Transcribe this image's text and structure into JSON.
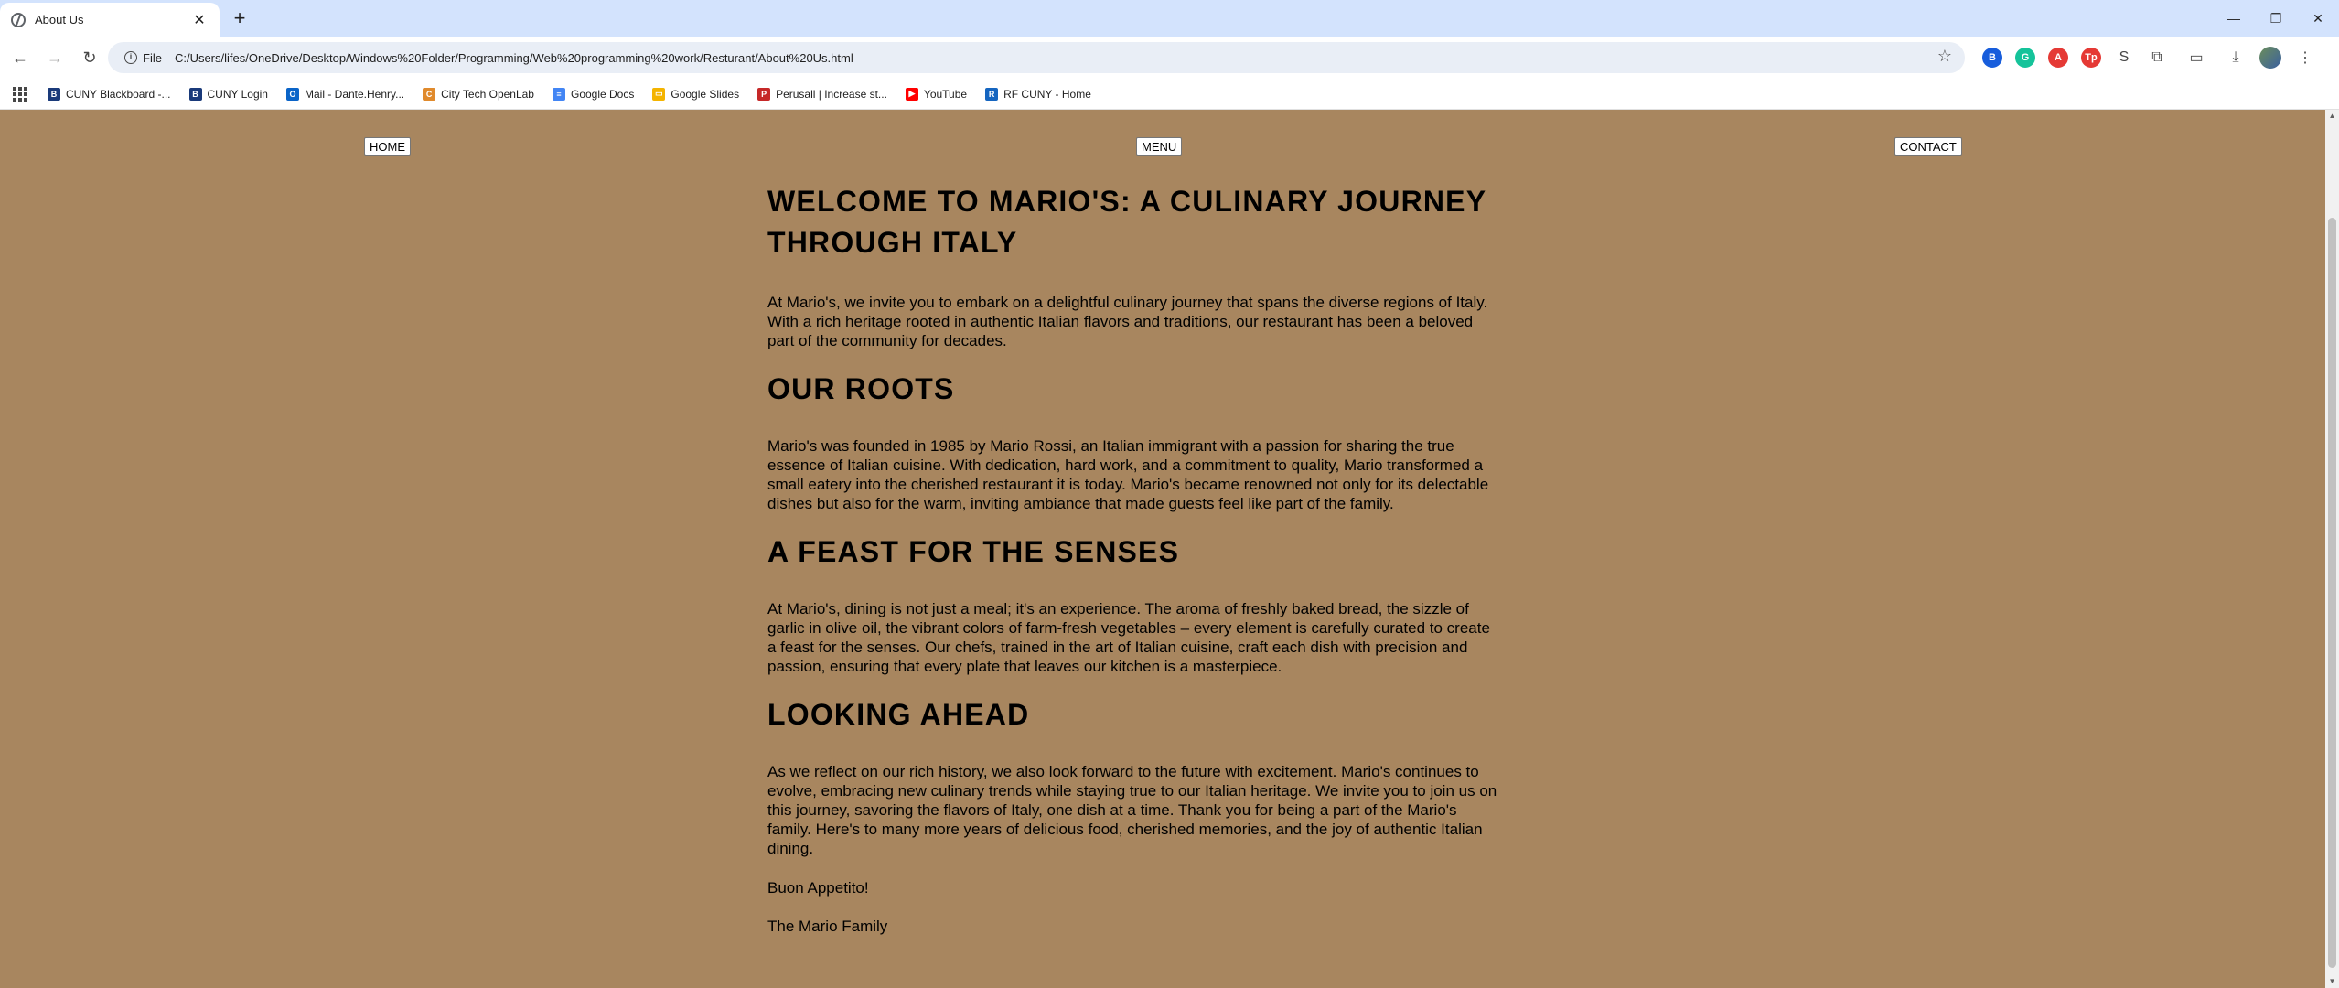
{
  "browser": {
    "tab_title": "About Us",
    "new_tab_symbol": "+",
    "site_chip": "File",
    "url": "C:/Users/lifes/OneDrive/Desktop/Windows%20Folder/Programming/Web%20programming%20work/Resturant/About%20Us.html",
    "bookmarks": [
      {
        "label": "CUNY Blackboard -...",
        "icon": "cuny-icon",
        "color": "#1a3a7a",
        "glyph": "B"
      },
      {
        "label": "CUNY Login",
        "icon": "cuny-icon",
        "color": "#1a3a7a",
        "glyph": "B"
      },
      {
        "label": "Mail - Dante.Henry...",
        "icon": "outlook-icon",
        "color": "#0a64c8",
        "glyph": "O"
      },
      {
        "label": "City Tech OpenLab",
        "icon": "openlab-icon",
        "color": "#e08a2c",
        "glyph": "C"
      },
      {
        "label": "Google Docs",
        "icon": "docs-icon",
        "color": "#4285f4",
        "glyph": "≡"
      },
      {
        "label": "Google Slides",
        "icon": "slides-icon",
        "color": "#f4b400",
        "glyph": "▭"
      },
      {
        "label": "Perusall | Increase st...",
        "icon": "perusall-icon",
        "color": "#c62828",
        "glyph": "P"
      },
      {
        "label": "YouTube",
        "icon": "youtube-icon",
        "color": "#ff0000",
        "glyph": "▶"
      },
      {
        "label": "RF CUNY - Home",
        "icon": "rfcuny-icon",
        "color": "#1565c0",
        "glyph": "R"
      }
    ],
    "extensions": [
      {
        "icon": "bitwarden-icon",
        "color": "#175ddc",
        "glyph": "B"
      },
      {
        "icon": "grammarly-icon",
        "color": "#15c39a",
        "glyph": "G"
      },
      {
        "icon": "adblock-icon",
        "color": "#e53935",
        "glyph": "A"
      },
      {
        "icon": "tp-icon",
        "color": "#e53935",
        "glyph": "Tp"
      },
      {
        "icon": "script-icon",
        "color": "",
        "glyph": "S"
      },
      {
        "icon": "puzzle-icon",
        "color": "",
        "glyph": "⧉"
      }
    ]
  },
  "nav": {
    "home": "HOME",
    "menu": "MENU",
    "contact": "CONTACT"
  },
  "article": {
    "title": "WELCOME TO MARIO'S: A CULINARY JOURNEY THROUGH ITALY",
    "intro": "At Mario's, we invite you to embark on a delightful culinary journey that spans the diverse regions of Italy. With a rich heritage rooted in authentic Italian flavors and traditions, our restaurant has been a beloved part of the community for decades.",
    "sections": [
      {
        "heading": "OUR ROOTS",
        "body": "Mario's was founded in 1985 by Mario Rossi, an Italian immigrant with a passion for sharing the true essence of Italian cuisine. With dedication, hard work, and a commitment to quality, Mario transformed a small eatery into the cherished restaurant it is today. Mario's became renowned not only for its delectable dishes but also for the warm, inviting ambiance that made guests feel like part of the family."
      },
      {
        "heading": "A FEAST FOR THE SENSES",
        "body": "At Mario's, dining is not just a meal; it's an experience. The aroma of freshly baked bread, the sizzle of garlic in olive oil, the vibrant colors of farm-fresh vegetables – every element is carefully curated to create a feast for the senses. Our chefs, trained in the art of Italian cuisine, craft each dish with precision and passion, ensuring that every plate that leaves our kitchen is a masterpiece."
      },
      {
        "heading": "LOOKING AHEAD",
        "body": "As we reflect on our rich history, we also look forward to the future with excitement. Mario's continues to evolve, embracing new culinary trends while staying true to our Italian heritage. We invite you to join us on this journey, savoring the flavors of Italy, one dish at a time. Thank you for being a part of the Mario's family. Here's to many more years of delicious food, cherished memories, and the joy of authentic Italian dining."
      }
    ],
    "closing": "Buon Appetito!",
    "signature": "The Mario Family"
  },
  "colors": {
    "page_background": "#a8865f",
    "tabstrip": "#d3e3fd"
  }
}
